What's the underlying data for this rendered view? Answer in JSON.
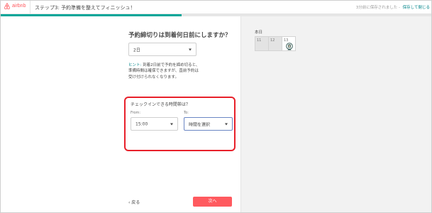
{
  "header": {
    "logo_text": "airbnb",
    "step_title": "ステップ3: 予約準備を整えてフィニッシュ！",
    "saved_text": "3分前に保存されました -",
    "save_exit": "保存して閉じる",
    "progress_fraction": 0.42
  },
  "main": {
    "question_title": "予約締切りは到着何日前にしますか？",
    "days_select": {
      "value": "2日"
    },
    "hint": {
      "label": "ヒント:",
      "line1": "到着2日前で予約を締め切ると、",
      "line2": "準備時間は確保できますが、直前予約は",
      "line3": "受け付けられなくなります。"
    },
    "checkin": {
      "question": "チェックインできる時間帯は？",
      "from_label": "From:",
      "to_label": "To:",
      "from_value": "15:00",
      "to_value": "時間を選択"
    },
    "back_label": "‹ 戻る",
    "next_label": "次へ"
  },
  "calendar": {
    "label": "本日",
    "days": [
      {
        "num": "11",
        "state": "past"
      },
      {
        "num": "12",
        "state": "past"
      },
      {
        "num": "13",
        "state": "today"
      }
    ]
  },
  "colors": {
    "brand": "#ff5a5f",
    "teal": "#008489",
    "highlight": "#e8202a"
  }
}
